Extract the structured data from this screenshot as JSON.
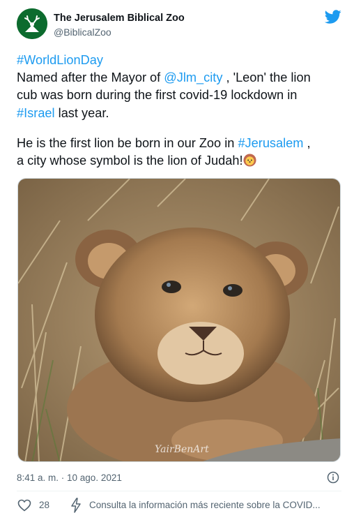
{
  "tweet": {
    "author_name": "The Jerusalem Biblical Zoo",
    "author_handle": "@BiblicalZoo",
    "text_lines": {
      "l1_tag": "#WorldLionDay",
      "l2_pre": "Named after the Mayor of ",
      "l2_mention": "@Jlm_city",
      "l2_post": " , 'Leon' the lion",
      "l3": "cub was born during the first covid-19 lockdown in",
      "l4_tag": "#Israel",
      "l4_post": " last year.",
      "l5_pre": "He is the first lion be born in our Zoo in ",
      "l5_tag": "#Jerusalem",
      "l5_post": " ,",
      "l6": "a city whose symbol is the lion of Judah!"
    },
    "photo_watermark": "YairBenArt",
    "timestamp": "8:41 a. m. · 10 ago. 2021",
    "like_count": "28",
    "covid_link": "Consulta la información más reciente sobre la COVID..."
  },
  "colors": {
    "link": "#1d9bf0",
    "brand_green": "#0c6b2e",
    "secondary_text": "#536471"
  },
  "icons": [
    "avatar-logo",
    "twitter-bird-icon",
    "lion-emoji",
    "info-icon",
    "heart-icon",
    "bolt-icon"
  ]
}
